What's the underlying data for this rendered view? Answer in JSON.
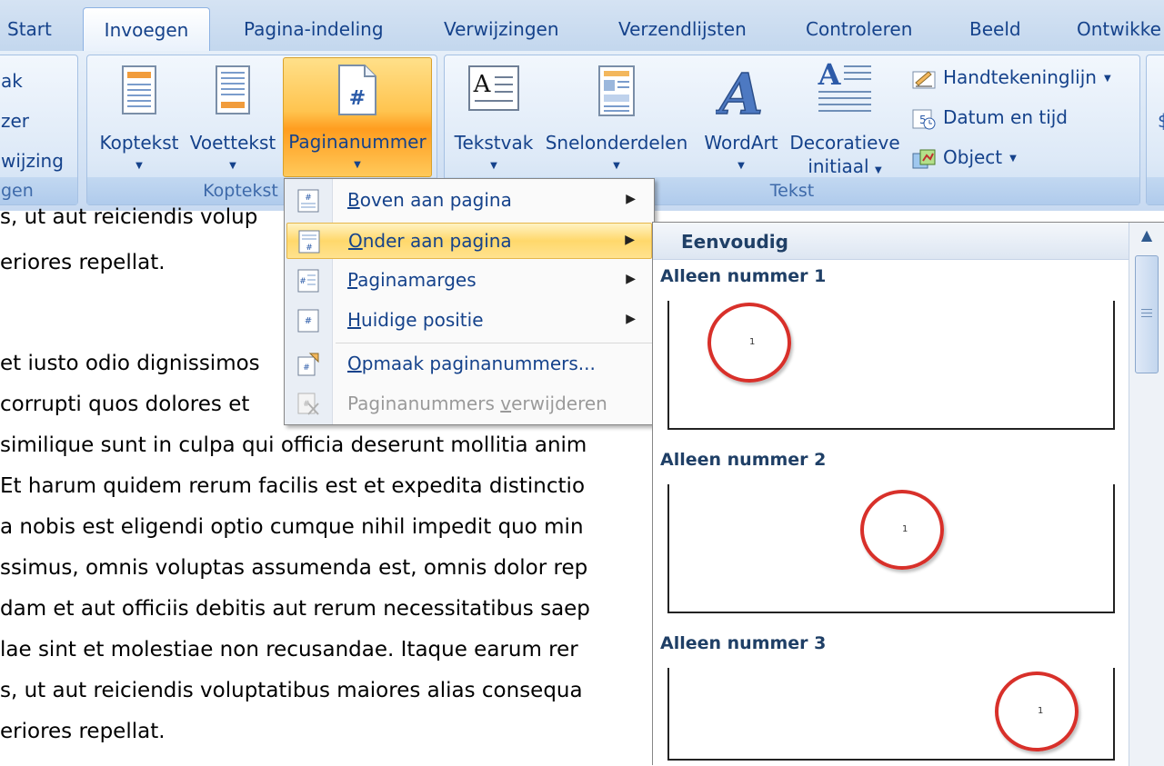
{
  "tabs": [
    "Start",
    "Invoegen",
    "Pagina-indeling",
    "Verwijzingen",
    "Verzendlijsten",
    "Controleren",
    "Beeld",
    "Ontwikke"
  ],
  "active_tab": "Invoegen",
  "ribbon": {
    "left_group": {
      "items": [
        "ak",
        "zer",
        "wijzing"
      ],
      "label": "gen"
    },
    "koptekst_group": {
      "label": "Koptekst en v",
      "buttons": [
        "Koptekst",
        "Voettekst",
        "Paginanummer"
      ]
    },
    "tekst_group": {
      "label": "Tekst",
      "buttons": [
        "Tekstvak",
        "Snelonderdelen",
        "WordArt"
      ],
      "decoratieve": {
        "line1": "Decoratieve",
        "line2": "initiaal"
      },
      "small_commands": [
        "Handtekeninglijn",
        "Datum en tijd",
        "Object"
      ]
    }
  },
  "document": {
    "lines": [
      "s, ut aut reiciendis volup",
      "eriores repellat.",
      "",
      "et iusto odio dignissimos",
      " corrupti quos dolores et",
      "similique sunt in culpa qui officia deserunt mollitia anim",
      " Et harum quidem rerum facilis est et expedita distinctio",
      "a nobis est eligendi optio cumque nihil impedit quo min",
      "ssimus, omnis voluptas assumenda est, omnis dolor rep",
      "dam et aut officiis debitis aut rerum necessitatibus saep",
      "lae sint et molestiae non recusandae. Itaque earum rer",
      "s, ut aut reiciendis voluptatibus maiores alias consequa",
      "eriores repellat."
    ]
  },
  "menu": {
    "items": [
      {
        "key": "B",
        "rest": "oven aan pagina"
      },
      {
        "key": "O",
        "rest": "nder aan pagina"
      },
      {
        "key": "P",
        "rest": "aginamarges"
      },
      {
        "key": "H",
        "rest": "uidige positie"
      },
      {
        "key": "O",
        "rest": "pmaak paginanummers..."
      },
      {
        "pre": "Paginanummers ",
        "key": "v",
        "rest": "erwijderen"
      }
    ]
  },
  "gallery": {
    "header": "Eenvoudig",
    "items": [
      {
        "title": "Alleen nummer 1",
        "number": "1"
      },
      {
        "title": "Alleen nummer 2",
        "number": "1"
      },
      {
        "title": "Alleen nummer 3",
        "number": "1"
      }
    ]
  },
  "colors": {
    "highlight": "#ffd86b",
    "ribbon_text": "#15428b",
    "circle": "#d8302a"
  }
}
